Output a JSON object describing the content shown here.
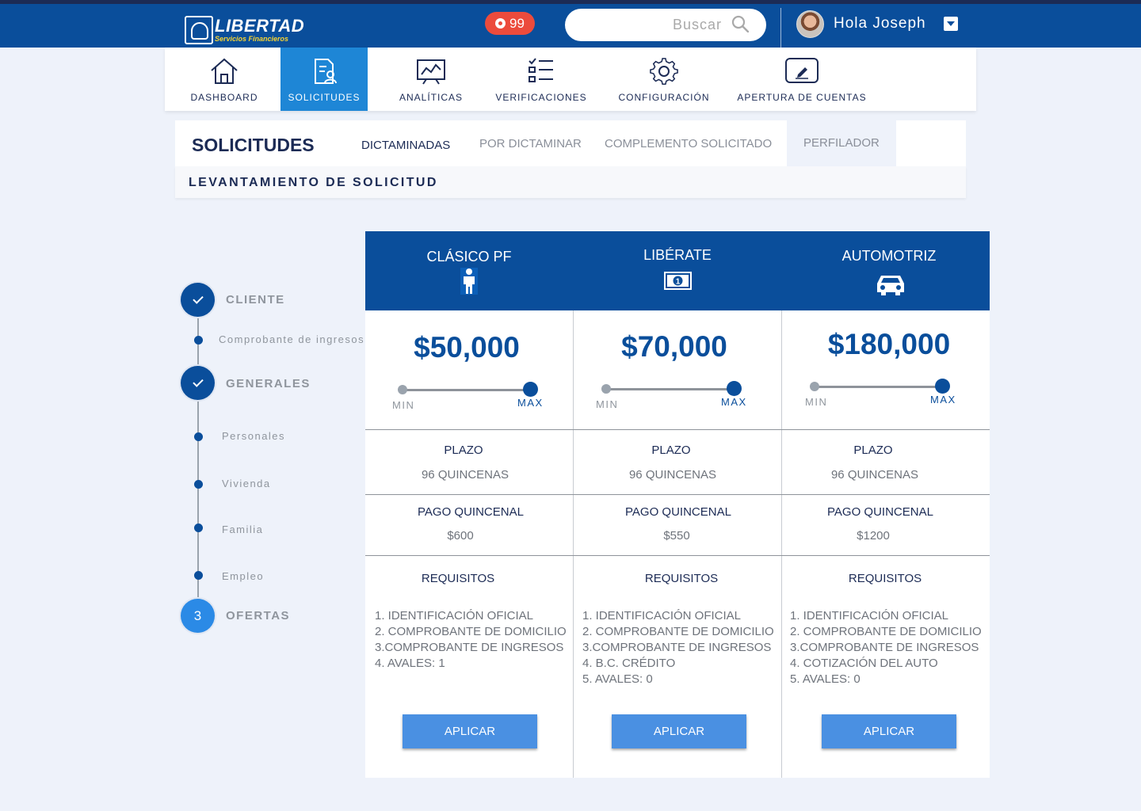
{
  "header": {
    "brand_name": "LIBERTAD",
    "brand_sub": "Servicios Financieros",
    "notifications_count": "99",
    "search_placeholder": "Buscar",
    "greeting": "Hola Joseph",
    "colors": {
      "bar": "#0a4e9b",
      "notification": "#ec4b3c"
    }
  },
  "nav": {
    "items": [
      {
        "label": "DASHBOARD",
        "icon": "home-icon"
      },
      {
        "label": "SOLICITUDES",
        "icon": "document-user-icon",
        "active": true
      },
      {
        "label": "ANALÍTICAS",
        "icon": "chart-board-icon"
      },
      {
        "label": "VERIFICACIONES",
        "icon": "checklist-icon"
      },
      {
        "label": "CONFIGURACIÓN",
        "icon": "gear-icon"
      },
      {
        "label": "APERTURA DE CUENTAS",
        "icon": "edit-card-icon"
      }
    ]
  },
  "section": {
    "title": "SOLICITUDES",
    "tabs": [
      "DICTAMINADAS",
      "POR DICTAMINAR",
      "COMPLEMENTO SOLICITADO",
      "PERFILADOR"
    ],
    "active_tab": "DICTAMINADAS",
    "subtitle": "LEVANTAMIENTO DE SOLICITUD"
  },
  "stepper": {
    "steps": [
      {
        "label": "CLIENTE",
        "status": "done",
        "subs": [
          "Comprobante de ingresos"
        ]
      },
      {
        "label": "GENERALES",
        "status": "done",
        "subs": [
          "Personales",
          "Vivienda",
          "Familia",
          "Empleo"
        ]
      },
      {
        "label": "OFERTAS",
        "status": "current",
        "number": "3",
        "subs": []
      }
    ]
  },
  "offers": [
    {
      "title": "CLÁSICO PF",
      "icon": "person-icon",
      "amount": "$50,000",
      "slider": {
        "min_label": "MIN",
        "max_label": "MAX",
        "level": 1.0
      },
      "plazo_label": "PLAZO",
      "plazo_value": "96 QUINCENAS",
      "pago_label": "PAGO QUINCENAL",
      "pago_value": "$600",
      "req_label": "REQUISITOS",
      "requisitos": [
        "1. IDENTIFICACIÓN OFICIAL",
        "2. COMPROBANTE DE DOMICILIO",
        "3.COMPROBANTE DE INGRESOS",
        "4. AVALES:  1"
      ],
      "button": "APLICAR"
    },
    {
      "title": "LIBÉRATE",
      "icon": "banknote-icon",
      "amount": "$70,000",
      "slider": {
        "min_label": "MIN",
        "max_label": "MAX",
        "level": 1.0
      },
      "plazo_label": "PLAZO",
      "plazo_value": "96 QUINCENAS",
      "pago_label": "PAGO QUINCENAL",
      "pago_value": "$550",
      "req_label": "REQUISITOS",
      "requisitos": [
        "1. IDENTIFICACIÓN OFICIAL",
        "2. COMPROBANTE DE DOMICILIO",
        "3.COMPROBANTE DE INGRESOS",
        "4. B.C. CRÉDITO",
        "5. AVALES:  0"
      ],
      "button": "APLICAR"
    },
    {
      "title": "AUTOMOTRIZ",
      "icon": "car-icon",
      "amount": "$180,000",
      "slider": {
        "min_label": "MIN",
        "max_label": "MAX",
        "level": 1.0
      },
      "plazo_label": "PLAZO",
      "plazo_value": "96 QUINCENAS",
      "pago_label": "PAGO QUINCENAL",
      "pago_value": "$1200",
      "req_label": "REQUISITOS",
      "requisitos": [
        "1. IDENTIFICACIÓN OFICIAL",
        "2. COMPROBANTE DE DOMICILIO",
        "3.COMPROBANTE DE INGRESOS",
        "4. COTIZACIÓN DEL AUTO",
        "5. AVALES:  0"
      ],
      "button": "APLICAR"
    }
  ]
}
